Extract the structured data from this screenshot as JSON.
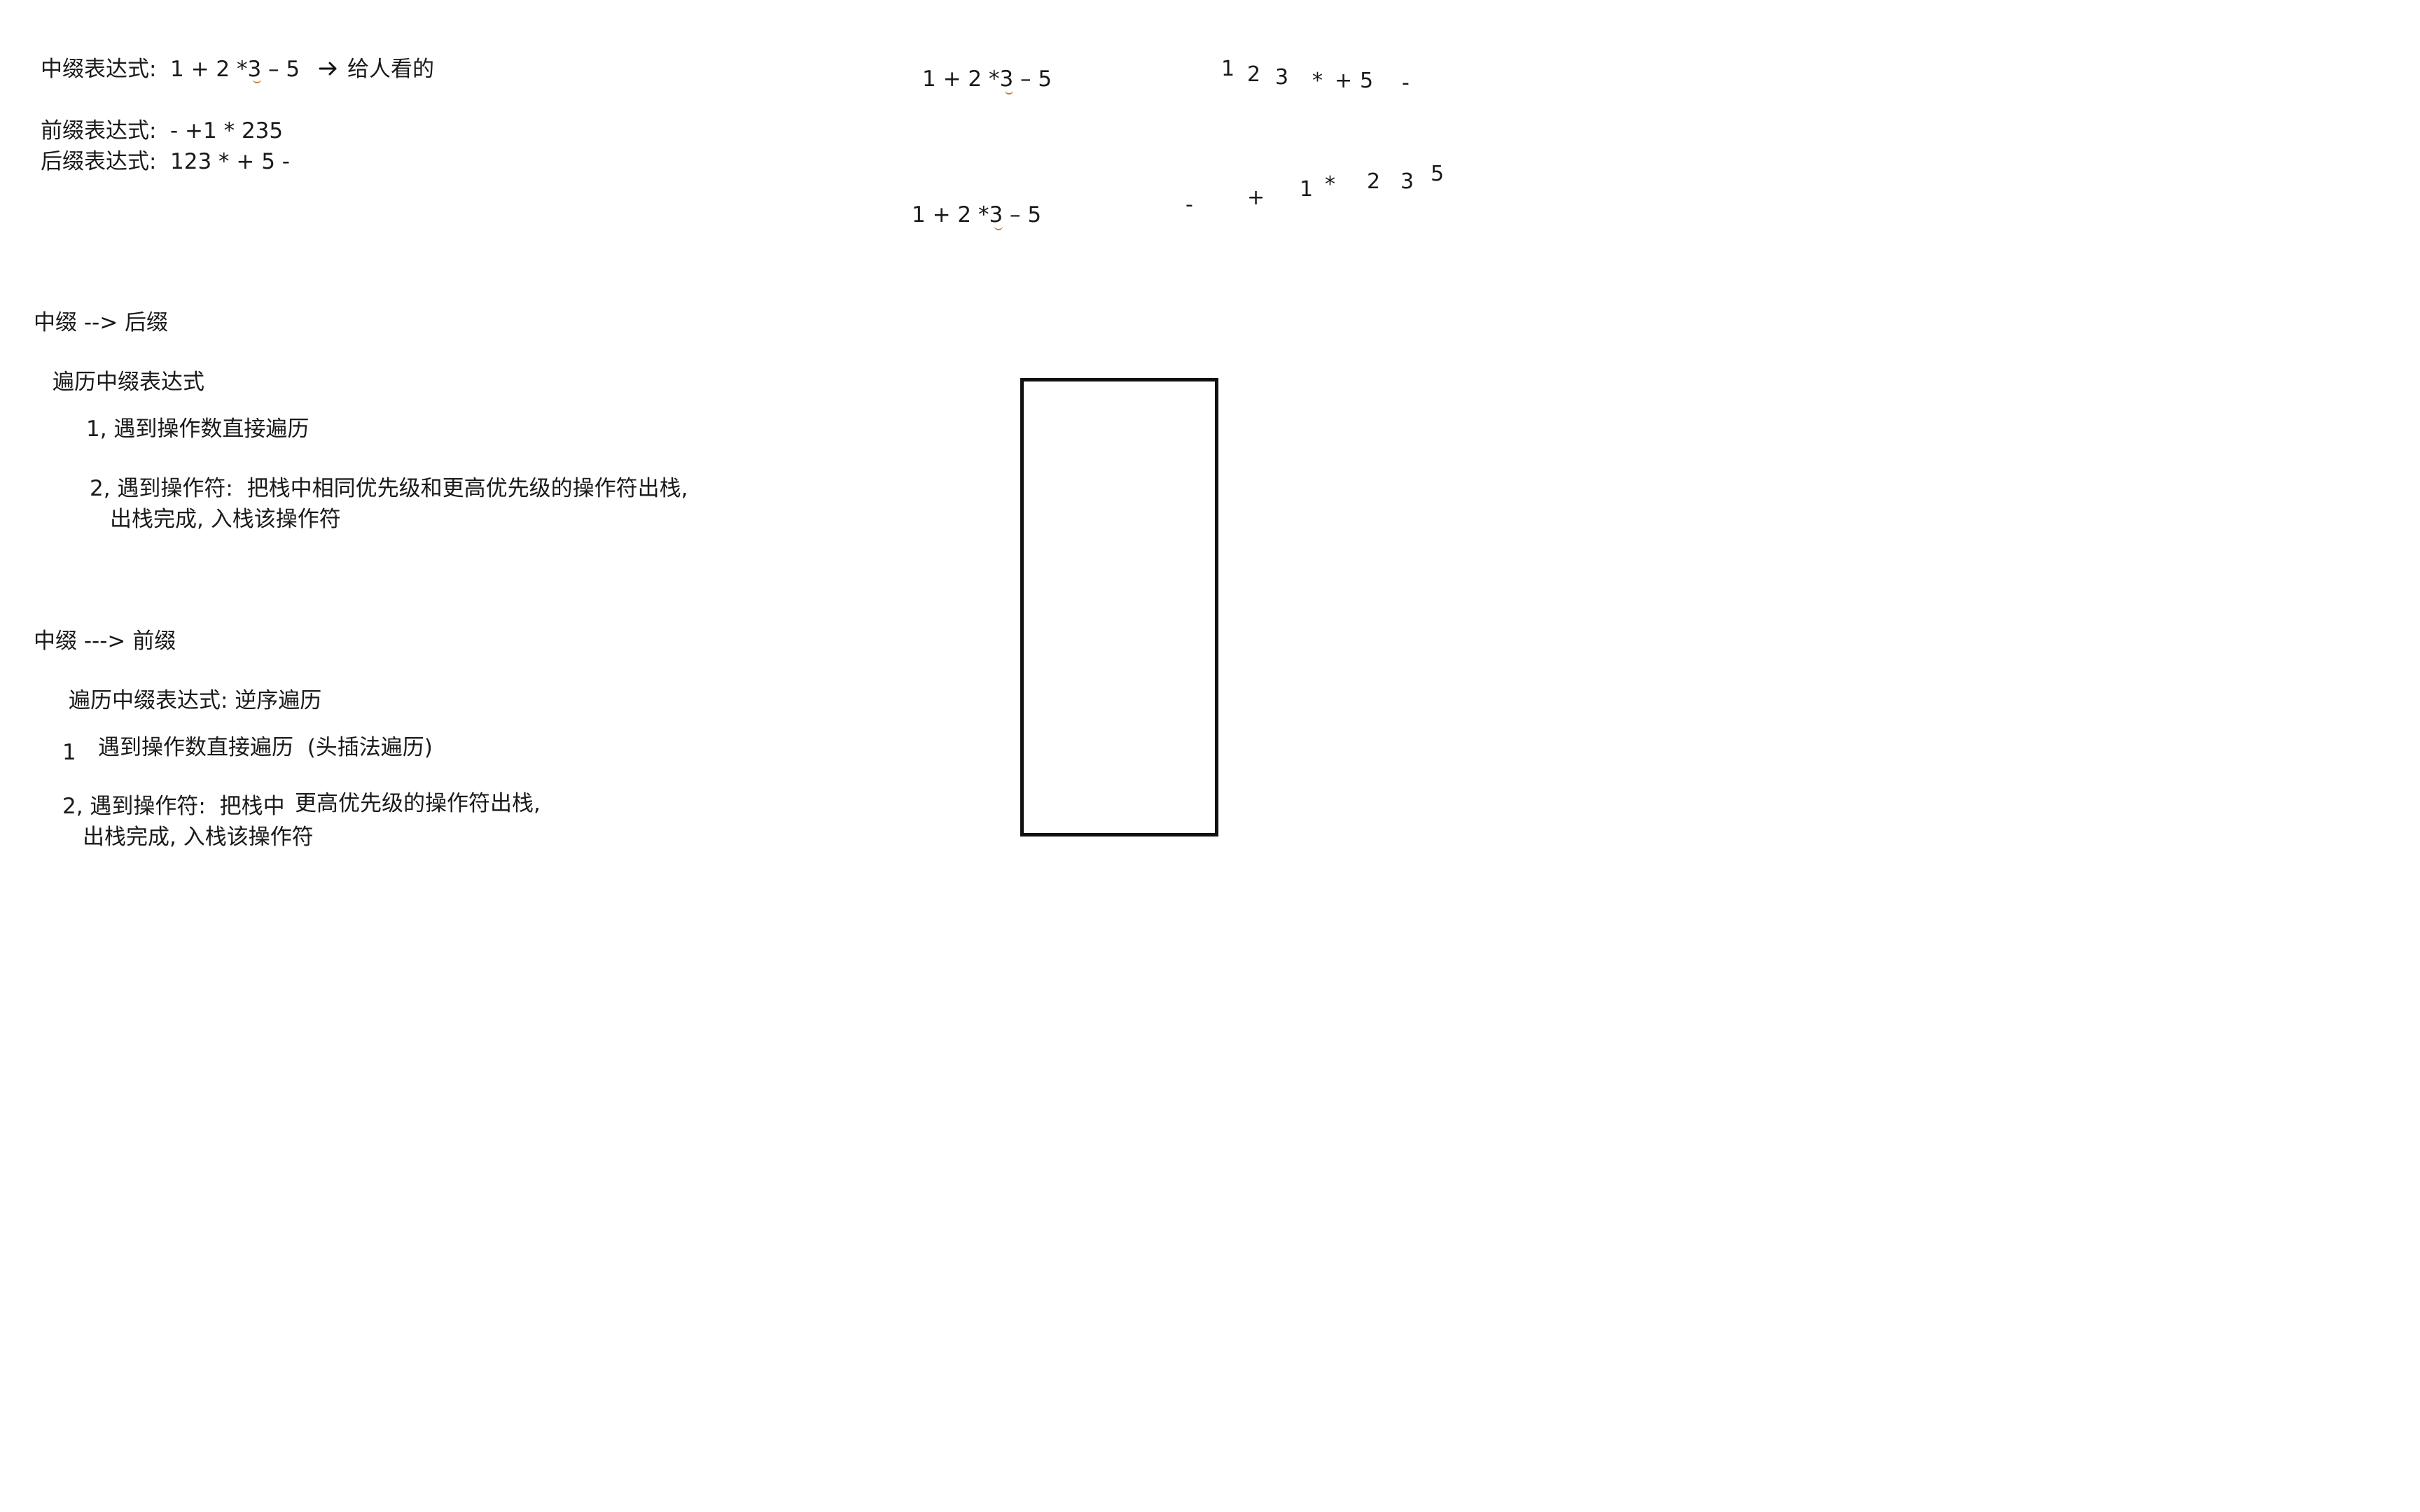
{
  "notes": {
    "infix_label": "中缀表达式:",
    "infix_expr": "1 + 2 *3 – 5",
    "infix_note": "给人看的",
    "prefix_label": "前缀表达式:",
    "prefix_expr": "- +1 * 235",
    "postfix_label": "后缀表达式:",
    "postfix_expr": "123 * + 5 -",
    "conv1_title": "中缀 --> 后缀",
    "conv1_traverse": "遍历中缀表达式",
    "conv1_step1": "1, 遇到操作数直接遍历",
    "conv1_step2_line1": "2, 遇到操作符:  把栈中相同优先级和更高优先级的操作符出栈,",
    "conv1_step2_line2": "出栈完成, 入栈该操作符",
    "conv2_title": "中缀 ---> 前缀",
    "conv2_traverse": "遍历中缀表达式: 逆序遍历",
    "conv2_step1_num": "1",
    "conv2_step1_text": "遇到操作数直接遍历  (头插法遍历)",
    "conv2_step2_line1a": "2, 遇到操作符:  把栈中",
    "conv2_step2_line1b": "更高优先级的操作符出栈,",
    "conv2_step2_line2": "出栈完成, 入栈该操作符"
  },
  "right_work": {
    "expr_top": "1 + 2 *3 – 5",
    "postfix_tokens": [
      "1",
      "2",
      "3",
      "*",
      "+",
      "5",
      "-"
    ],
    "expr_bottom": "1 + 2 *3 – 5",
    "prefix_tokens": [
      "-",
      "+",
      "1",
      "*",
      "2",
      "3",
      "5"
    ]
  },
  "icons": {
    "arrow": "right-arrow-icon"
  }
}
